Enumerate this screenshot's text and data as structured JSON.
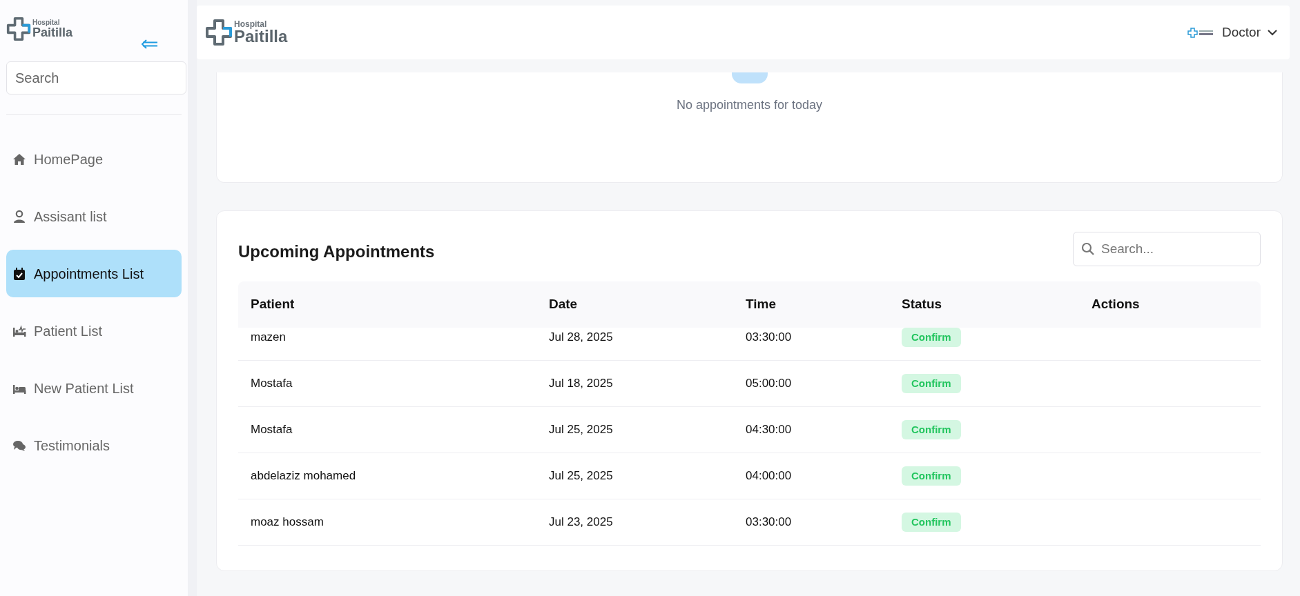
{
  "sidebar": {
    "logo": {
      "small": "Hospital",
      "large": "Paitilla"
    },
    "search": {
      "placeholder": "Search"
    },
    "items": [
      {
        "label": "HomePage",
        "selected": false
      },
      {
        "label": "Assisant list",
        "selected": false
      },
      {
        "label": "Appointments List",
        "selected": true
      },
      {
        "label": "Patient List",
        "selected": false
      },
      {
        "label": "New Patient List",
        "selected": false
      },
      {
        "label": "Testimonials",
        "selected": false
      }
    ]
  },
  "header": {
    "logo": {
      "small": "Hospital",
      "large": "Paitilla"
    },
    "user": "Doctor"
  },
  "today": {
    "message": "No appointments for today"
  },
  "upcoming": {
    "title": "Upcoming Appointments",
    "search": {
      "placeholder": "Search..."
    },
    "columns": [
      "Patient",
      "Date",
      "Time",
      "Status",
      "Actions"
    ],
    "rows": [
      {
        "patient": "mazen",
        "date": "Jul 28, 2025",
        "time": "03:30:00",
        "status": "Confirm"
      },
      {
        "patient": "Mostafa",
        "date": "Jul 18, 2025",
        "time": "05:00:00",
        "status": "Confirm"
      },
      {
        "patient": "Mostafa",
        "date": "Jul 25, 2025",
        "time": "04:30:00",
        "status": "Confirm"
      },
      {
        "patient": "abdelaziz mohamed",
        "date": "Jul 25, 2025",
        "time": "04:00:00",
        "status": "Confirm"
      },
      {
        "patient": "moaz hossam",
        "date": "Jul 23, 2025",
        "time": "03:30:00",
        "status": "Confirm"
      }
    ]
  }
}
